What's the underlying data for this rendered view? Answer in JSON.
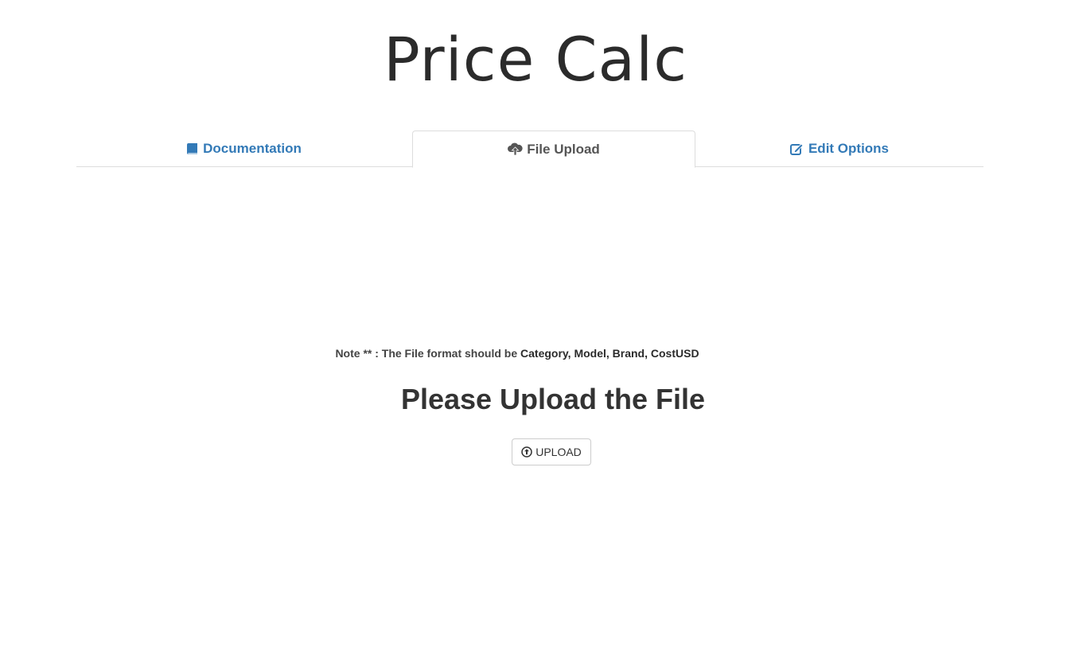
{
  "app": {
    "title": "Price Calc"
  },
  "tabs": [
    {
      "label": "Documentation",
      "icon": "book-icon",
      "active": false
    },
    {
      "label": "File Upload",
      "icon": "cloud-upload-icon",
      "active": true
    },
    {
      "label": "Edit Options",
      "icon": "edit-icon",
      "active": false
    }
  ],
  "upload": {
    "note_prefix": "Note ** : The File format should be ",
    "note_format": "Category, Model, Brand, CostUSD",
    "heading": "Please Upload the File",
    "button_label": "UPLOAD",
    "button_icon": "circle-arrow-up-icon"
  },
  "colors": {
    "link": "#337ab7",
    "active_tab_text": "#555555",
    "border": "#dddddd"
  }
}
